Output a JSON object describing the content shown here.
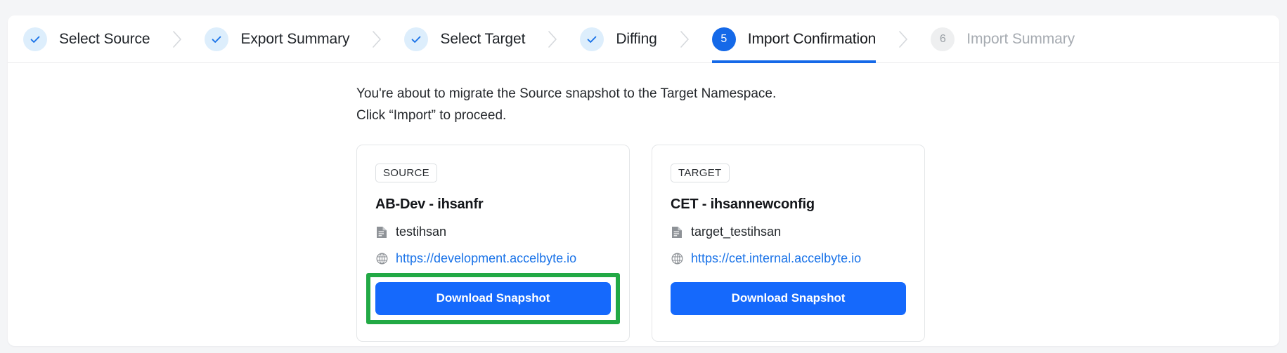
{
  "stepper": {
    "steps": [
      {
        "label": "Select Source",
        "state": "done",
        "marker": "check-icon"
      },
      {
        "label": "Export Summary",
        "state": "done",
        "marker": "check-icon"
      },
      {
        "label": "Select Target",
        "state": "done",
        "marker": "check-icon"
      },
      {
        "label": "Diffing",
        "state": "done",
        "marker": "check-icon"
      },
      {
        "label": "Import Confirmation",
        "state": "active",
        "marker": "5"
      },
      {
        "label": "Import Summary",
        "state": "pending",
        "marker": "6"
      }
    ]
  },
  "main": {
    "intro_line1": "You're about to migrate the Source snapshot to the Target Namespace.",
    "intro_line2": "Click “Import” to proceed.",
    "panels": [
      {
        "tag": "SOURCE",
        "title": "AB-Dev - ihsanfr",
        "file_name": "testihsan",
        "url": "https://development.accelbyte.io",
        "button_label": "Download Snapshot",
        "highlighted": true
      },
      {
        "tag": "TARGET",
        "title": "CET - ihsannewconfig",
        "file_name": "target_testihsan",
        "url": "https://cet.internal.accelbyte.io",
        "button_label": "Download Snapshot",
        "highlighted": false
      }
    ]
  },
  "colors": {
    "accent_blue": "#1569fc",
    "step_active_blue": "#1569e8",
    "link_blue": "#1a73e8",
    "highlight_green": "#22a945",
    "page_bg": "#f4f5f7"
  }
}
